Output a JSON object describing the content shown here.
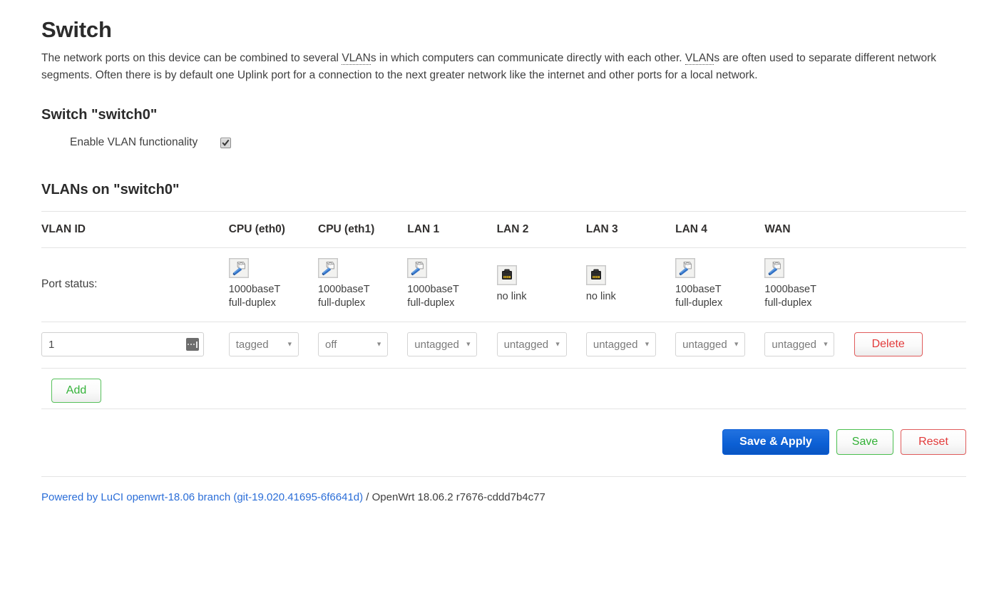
{
  "page": {
    "title": "Switch",
    "intro_parts": {
      "p1": "The network ports on this device can be combined to several ",
      "abbr1": "VLAN",
      "p2": "s in which computers can communicate directly with each other. ",
      "abbr2": "VLAN",
      "p3": "s are often used to separate different network segments. Often there is by default one Uplink port for a connection to the next greater network like the internet and other ports for a local network."
    }
  },
  "switch_section": {
    "title": "Switch \"switch0\"",
    "enable_vlan_label": "Enable VLAN functionality",
    "enable_vlan_checked": true
  },
  "vlan_section": {
    "title": "VLANs on \"switch0\"",
    "columns": [
      "VLAN ID",
      "CPU (eth0)",
      "CPU (eth1)",
      "LAN 1",
      "LAN 2",
      "LAN 3",
      "LAN 4",
      "WAN"
    ],
    "port_status_label": "Port status:",
    "port_status": [
      {
        "icon": "ethernet-connected-icon",
        "speed": "1000baseT",
        "duplex": "full-duplex",
        "linked": true
      },
      {
        "icon": "ethernet-connected-icon",
        "speed": "1000baseT",
        "duplex": "full-duplex",
        "linked": true
      },
      {
        "icon": "ethernet-connected-icon",
        "speed": "1000baseT",
        "duplex": "full-duplex",
        "linked": true
      },
      {
        "icon": "ethernet-nolink-icon",
        "speed": "no link",
        "duplex": "",
        "linked": false
      },
      {
        "icon": "ethernet-nolink-icon",
        "speed": "no link",
        "duplex": "",
        "linked": false
      },
      {
        "icon": "ethernet-connected-icon",
        "speed": "100baseT",
        "duplex": "full-duplex",
        "linked": true
      },
      {
        "icon": "ethernet-connected-icon",
        "speed": "1000baseT",
        "duplex": "full-duplex",
        "linked": true
      }
    ],
    "rows": [
      {
        "vlan_id": "1",
        "vlan_id_placeholder": "",
        "ports": [
          {
            "value": "tagged"
          },
          {
            "value": "off"
          },
          {
            "value": "untagged"
          },
          {
            "value": "untagged"
          },
          {
            "value": "untagged"
          },
          {
            "value": "untagged"
          },
          {
            "value": "untagged"
          }
        ],
        "delete_label": "Delete"
      }
    ],
    "port_options": [
      "untagged",
      "tagged",
      "off"
    ],
    "add_label": "Add"
  },
  "actions": {
    "save_apply_label": "Save & Apply",
    "save_label": "Save",
    "reset_label": "Reset"
  },
  "footer": {
    "link_text": "Powered by LuCI openwrt-18.06 branch (git-19.020.41695-6f6641d)",
    "suffix_text": " / OpenWrt 18.06.2 r7676-cddd7b4c77"
  },
  "colors": {
    "accent_blue": "#0b5fd4",
    "green": "#32b036",
    "red": "#e23a3a",
    "link": "#2b6ed8"
  }
}
